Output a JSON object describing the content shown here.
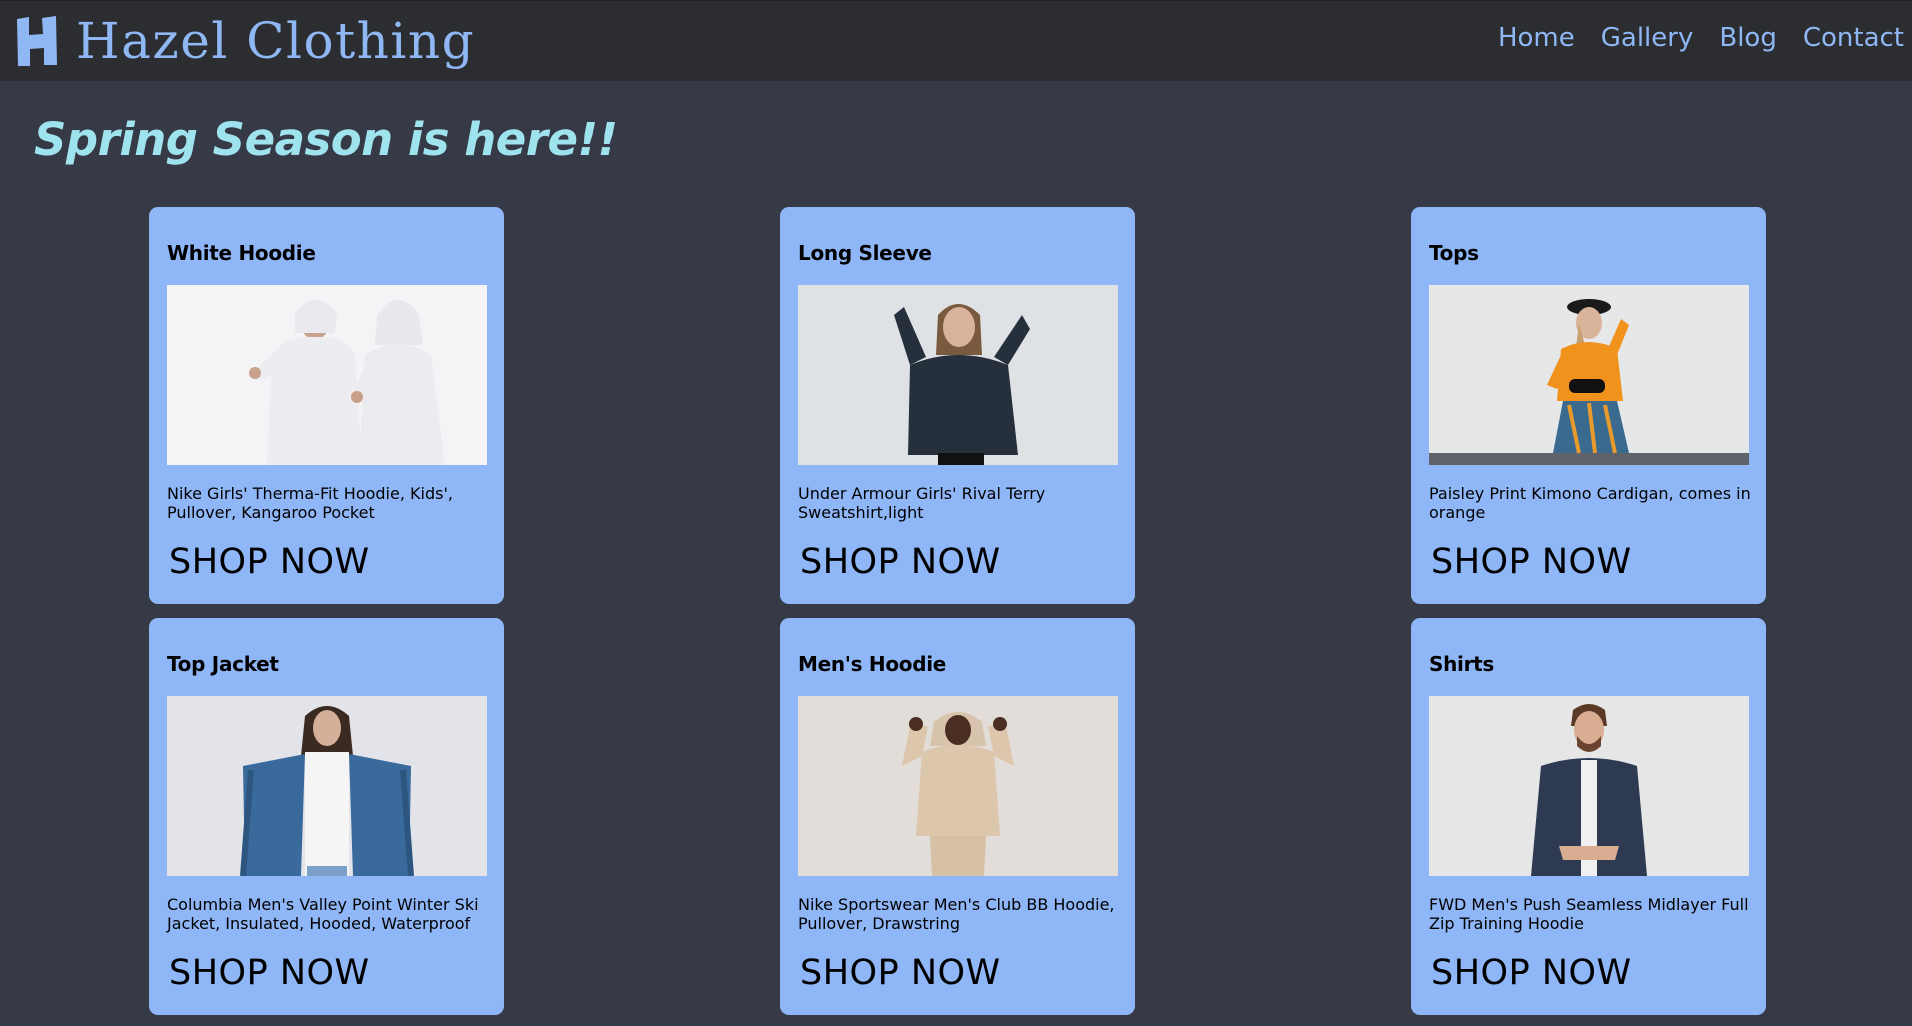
{
  "brand": {
    "name": "Hazel Clothing",
    "logo_icon": "h-logo-icon",
    "color": "#8fb7f4"
  },
  "nav": {
    "items": [
      {
        "label": "Home"
      },
      {
        "label": "Gallery"
      },
      {
        "label": "Blog"
      },
      {
        "label": "Contact"
      }
    ]
  },
  "hero": {
    "headline": "Spring Season is here!!"
  },
  "products": [
    {
      "title": "White Hoodie",
      "description": "Nike Girls' Therma-Fit Hoodie, Kids', Pullover, Kangaroo Pocket",
      "cta": "SHOP NOW",
      "image": "woman-white-hoodie-photo"
    },
    {
      "title": "Long Sleeve",
      "description": "Under Armour Girls' Rival Terry Sweatshirt,light",
      "cta": "SHOP NOW",
      "image": "woman-dark-long-sleeve-photo"
    },
    {
      "title": "Tops",
      "description": "Paisley Print Kimono Cardigan, comes in orange",
      "cta": "SHOP NOW",
      "image": "woman-orange-top-photo"
    },
    {
      "title": "Top Jacket",
      "description": "Columbia Men's Valley Point Winter Ski Jacket, Insulated, Hooded, Waterproof",
      "cta": "SHOP NOW",
      "image": "person-denim-jacket-photo"
    },
    {
      "title": "Men's Hoodie",
      "description": "Nike Sportswear Men's Club BB Hoodie, Pullover, Drawstring",
      "cta": "SHOP NOW",
      "image": "man-beige-hoodie-photo"
    },
    {
      "title": "Shirts",
      "description": "FWD Men's Push Seamless Midlayer Full Zip Training Hoodie",
      "cta": "SHOP NOW",
      "image": "man-navy-shirt-photo"
    }
  ],
  "colors": {
    "page_bg": "#363a46",
    "navbar_bg": "#2b2d31",
    "card_bg": "#8fb6f6",
    "headline": "#9fe3ee"
  }
}
